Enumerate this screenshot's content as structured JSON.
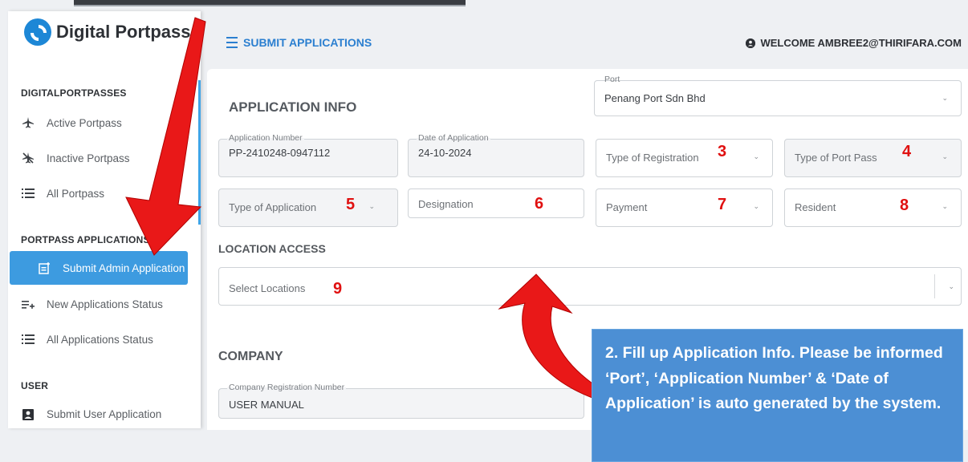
{
  "app": {
    "name": "Digital Portpass"
  },
  "sidebar": {
    "sections": [
      {
        "title": "DIGITALPORTPASSES",
        "items": [
          {
            "label": "Active Portpass",
            "icon": "airplane-icon"
          },
          {
            "label": "Inactive Portpass",
            "icon": "airplane-off-icon"
          },
          {
            "label": "All Portpass",
            "icon": "list-icon"
          }
        ]
      },
      {
        "title": "PORTPASS APPLICATIONS",
        "items": [
          {
            "label": "Submit Admin Application",
            "icon": "document-add-icon",
            "active": true
          },
          {
            "label": "New Applications Status",
            "icon": "playlist-add-icon"
          },
          {
            "label": "All Applications Status",
            "icon": "list-icon"
          }
        ]
      },
      {
        "title": "USER",
        "items": [
          {
            "label": "Submit User Application",
            "icon": "id-badge-icon"
          }
        ]
      }
    ]
  },
  "header": {
    "title": "SUBMIT APPLICATIONS",
    "welcome": "WELCOME AMBREE2@THIRIFARA.COM"
  },
  "form": {
    "application_info_title": "APPLICATION INFO",
    "port": {
      "label": "Port",
      "value": "Penang Port Sdn Bhd"
    },
    "application_number": {
      "label": "Application Number",
      "value": "PP-2410248-0947112"
    },
    "date_of_application": {
      "label": "Date of Application",
      "value": "24-10-2024"
    },
    "type_of_registration": {
      "placeholder": "Type of Registration"
    },
    "type_of_port_pass": {
      "placeholder": "Type of Port Pass"
    },
    "type_of_application": {
      "placeholder": "Type of Application"
    },
    "designation": {
      "placeholder": "Designation"
    },
    "payment": {
      "placeholder": "Payment"
    },
    "resident": {
      "placeholder": "Resident"
    },
    "location_access_title": "LOCATION ACCESS",
    "select_locations": {
      "placeholder": "Select Locations"
    },
    "company_title": "COMPANY",
    "company_registration_number": {
      "label": "Company Registration Number",
      "value": "USER MANUAL"
    }
  },
  "annotations": {
    "markers": [
      "3",
      "4",
      "5",
      "6",
      "7",
      "8",
      "9"
    ],
    "callout_text": "2. Fill up Application Info. Please be informed ‘Port’, ‘Application Number’ & ‘Date of Application’ is auto generated by the system.",
    "marker_color": "#e01010",
    "callout_color": "#4c8fd4"
  },
  "colors": {
    "accent": "#2b7fd0",
    "active_nav": "#3d9be0"
  }
}
